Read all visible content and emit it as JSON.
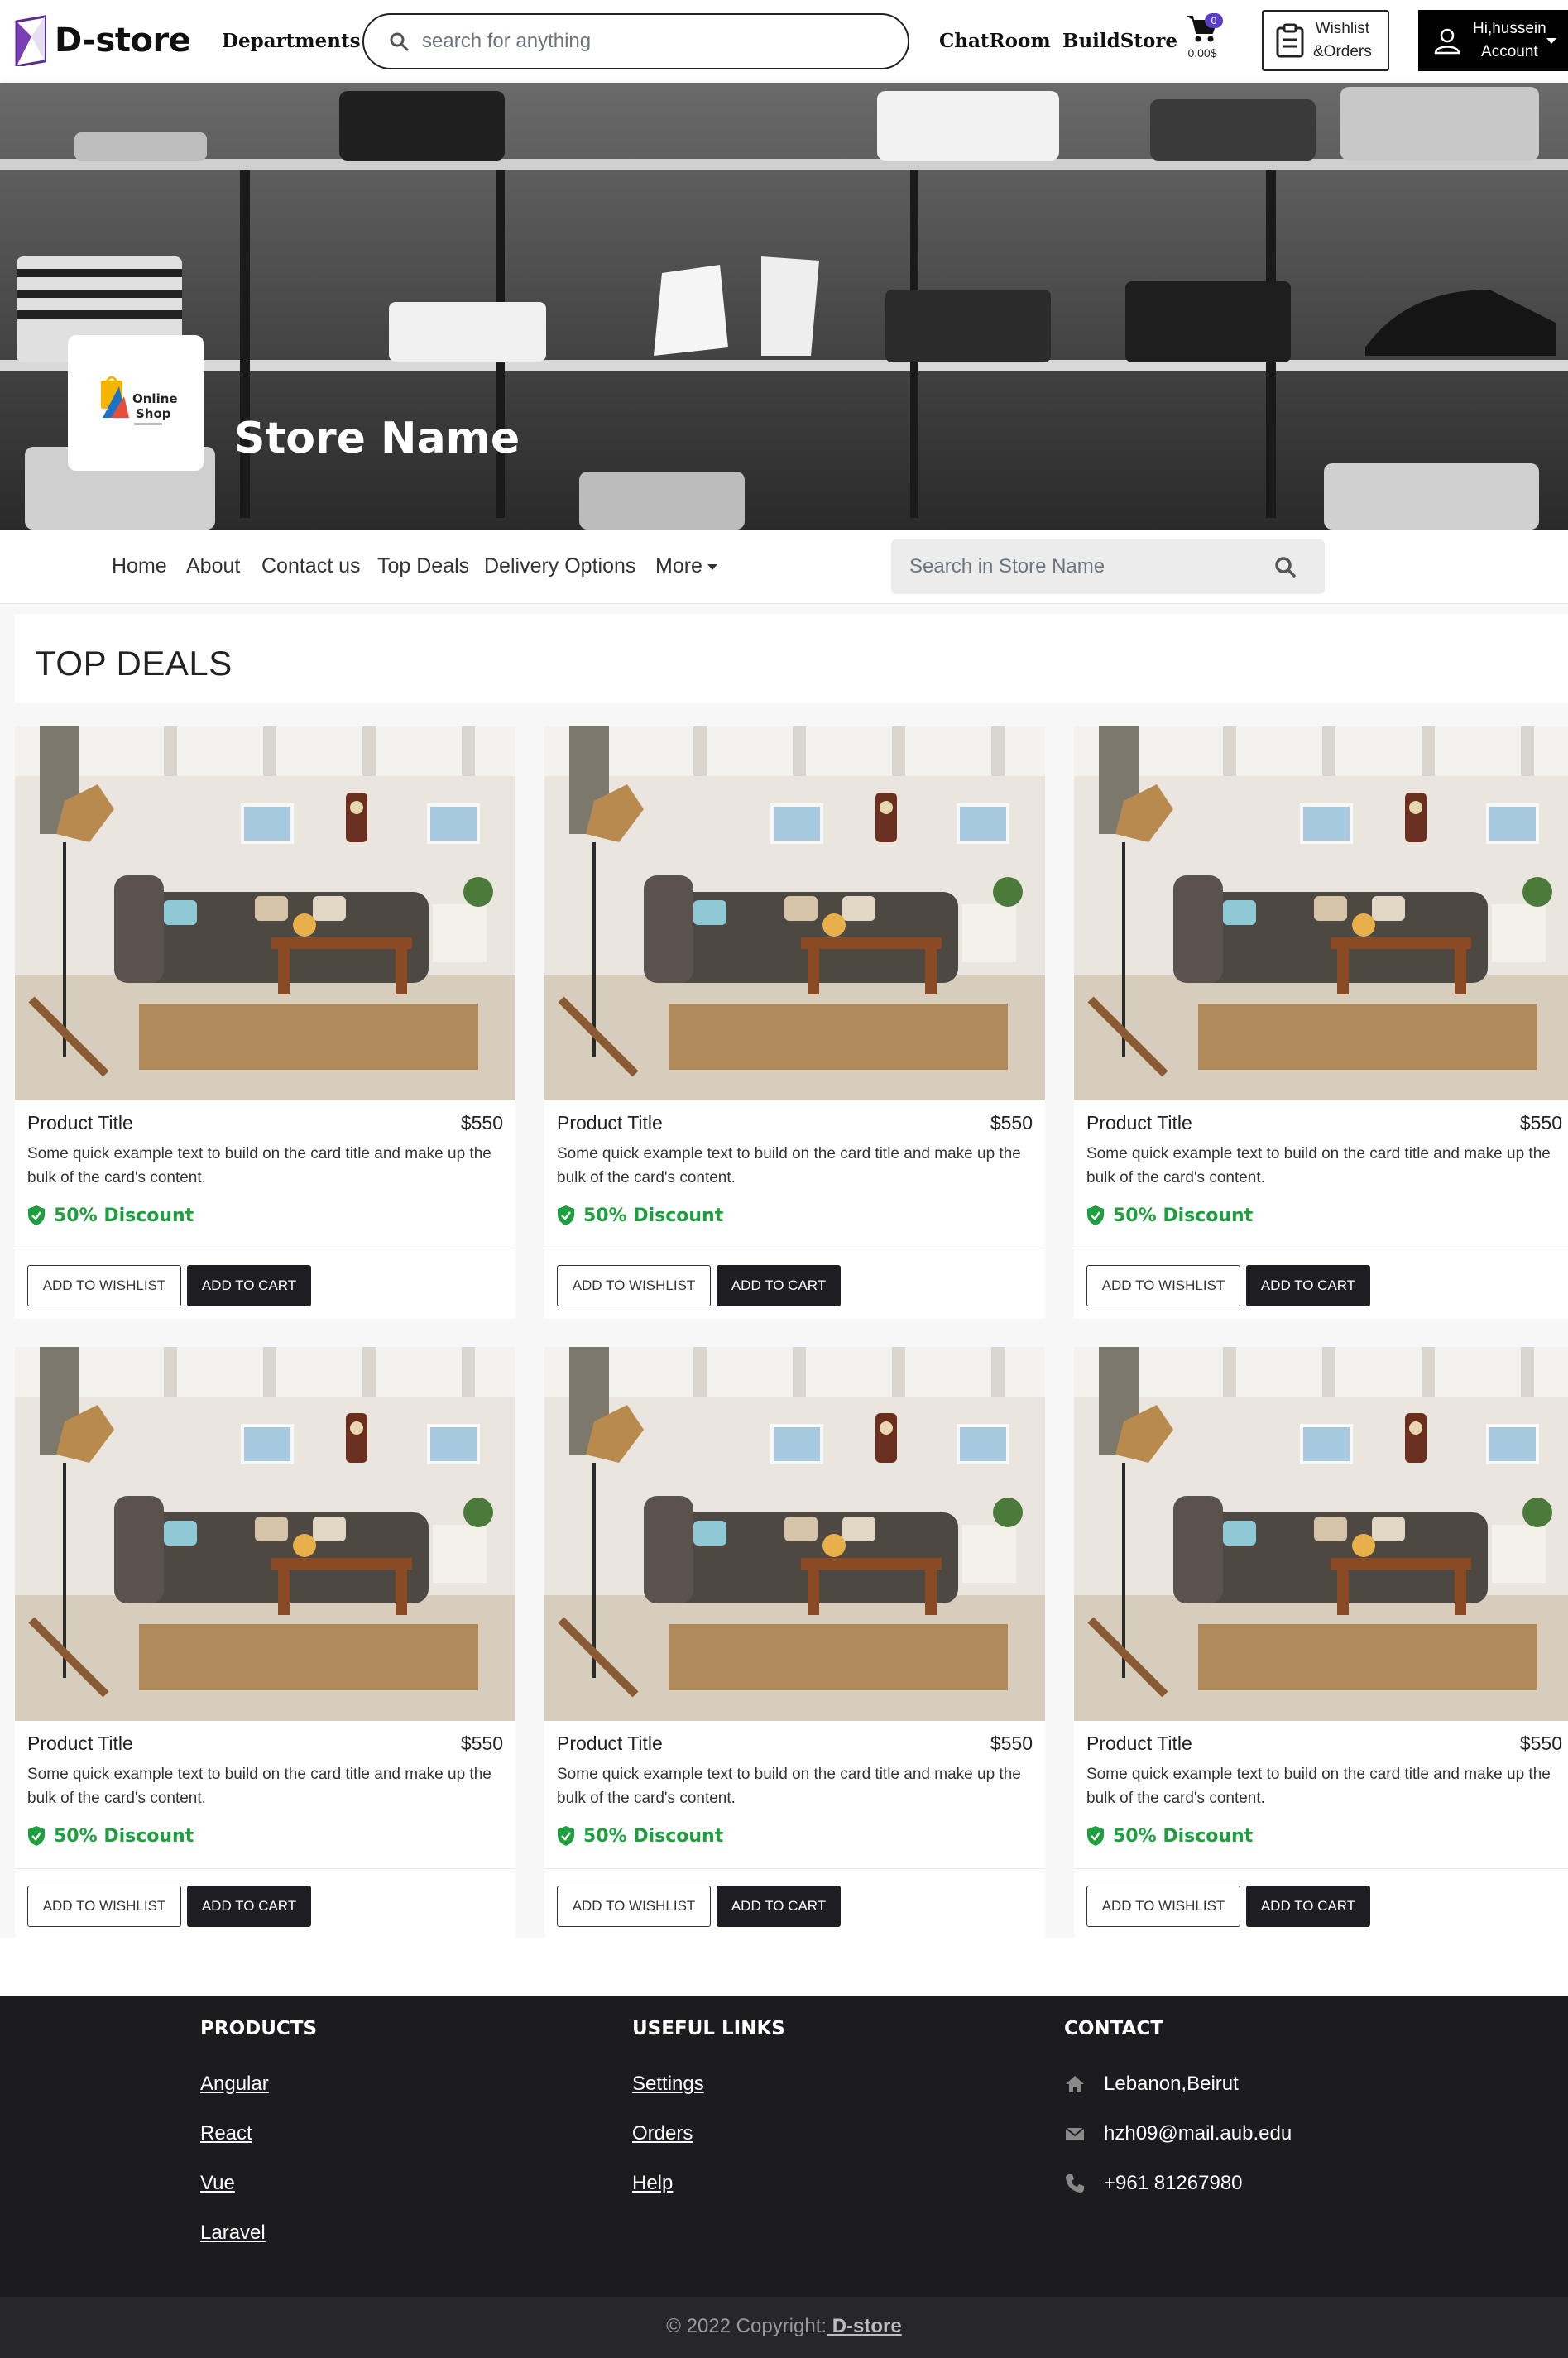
{
  "header": {
    "brand": "D-store",
    "departments_label": "Departments",
    "search_placeholder": "search for anything",
    "chatroom_label": "ChatRoom",
    "buildstore_label": "BuildStore",
    "cart_count": "0",
    "cart_amount": "0.00$",
    "wishlist_label": "Wishlist\n&Orders",
    "account_greeting": "Hi,hussein",
    "account_label": "Account"
  },
  "banner": {
    "store_name": "Store Name",
    "logo_text_line1": "Online",
    "logo_text_line2": "Shop"
  },
  "store_nav": {
    "items": [
      "Home",
      "About",
      "Contact us",
      "Top Deals",
      "Delivery Options"
    ],
    "more_label": "More",
    "search_placeholder": "Search in Store Name"
  },
  "deals": {
    "heading": "TOP DEALS",
    "cards": [
      {
        "title": "Product Title",
        "price": "$550",
        "text": "Some quick example text to build on the card title and make up the bulk of the card's content.",
        "discount": "50% Discount",
        "wishlist_label": "ADD TO WISHLIST",
        "cart_label": "ADD TO CART"
      },
      {
        "title": "Product Title",
        "price": "$550",
        "text": "Some quick example text to build on the card title and make up the bulk of the card's content.",
        "discount": "50% Discount",
        "wishlist_label": "ADD TO WISHLIST",
        "cart_label": "ADD TO CART"
      },
      {
        "title": "Product Title",
        "price": "$550",
        "text": "Some quick example text to build on the card title and make up the bulk of the card's content.",
        "discount": "50% Discount",
        "wishlist_label": "ADD TO WISHLIST",
        "cart_label": "ADD TO CART"
      },
      {
        "title": "Product Title",
        "price": "$550",
        "text": "Some quick example text to build on the card title and make up the bulk of the card's content.",
        "discount": "50% Discount",
        "wishlist_label": "ADD TO WISHLIST",
        "cart_label": "ADD TO CART"
      },
      {
        "title": "Product Title",
        "price": "$550",
        "text": "Some quick example text to build on the card title and make up the bulk of the card's content.",
        "discount": "50% Discount",
        "wishlist_label": "ADD TO WISHLIST",
        "cart_label": "ADD TO CART"
      },
      {
        "title": "Product Title",
        "price": "$550",
        "text": "Some quick example text to build on the card title and make up the bulk of the card's content.",
        "discount": "50% Discount",
        "wishlist_label": "ADD TO WISHLIST",
        "cart_label": "ADD TO CART"
      }
    ]
  },
  "footer": {
    "products_heading": "PRODUCTS",
    "products": [
      "Angular",
      "React",
      "Vue",
      "Laravel"
    ],
    "links_heading": "USEFUL LINKS",
    "links": [
      "Settings",
      "Orders",
      "Help"
    ],
    "contact_heading": "CONTACT",
    "contact": {
      "address": "Lebanon,Beirut",
      "email": "hzh09@mail.aub.edu",
      "phone": "+961 81267980"
    },
    "copyright_prefix": "© 2022 Copyright:",
    "copyright_brand": " D-store"
  },
  "colors": {
    "discount_green": "#1e9e3e",
    "cart_badge": "#5b3cc4",
    "footer_bg": "#1c1c1f",
    "dark_button": "#1d1d22"
  }
}
